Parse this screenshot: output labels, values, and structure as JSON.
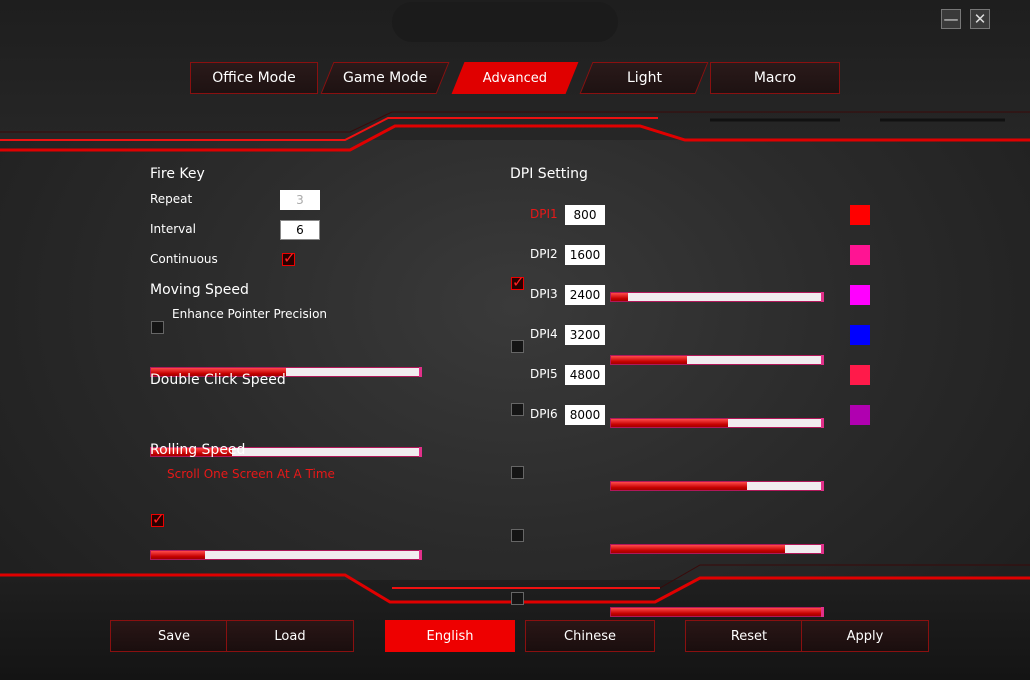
{
  "tabs": [
    {
      "label": "Office Mode"
    },
    {
      "label": "Game Mode"
    },
    {
      "label": "Advanced"
    },
    {
      "label": "Light"
    },
    {
      "label": "Macro"
    }
  ],
  "active_tab": "Advanced",
  "fire_key": {
    "title": "Fire Key",
    "repeat_label": "Repeat",
    "repeat_value": "3",
    "interval_label": "Interval",
    "interval_value": "6",
    "continuous_label": "Continuous",
    "continuous_checked": true
  },
  "moving_speed": {
    "title": "Moving Speed",
    "enhance_label": "Enhance Pointer Precision",
    "enhance_checked": false,
    "level": 0.5
  },
  "double_click": {
    "title": "Double Click Speed",
    "level": 0.3
  },
  "rolling": {
    "title": "Rolling Speed",
    "scroll_label": "Scroll One Screen At A Time",
    "scroll_checked": true,
    "level": 0.2
  },
  "dpi": {
    "title": "DPI Setting",
    "rows": [
      {
        "label": "DPI1",
        "value": "800",
        "checked": true,
        "level": 0.08,
        "color": "#ff0000"
      },
      {
        "label": "DPI2",
        "value": "1600",
        "checked": false,
        "level": 0.36,
        "color": "#ff1493"
      },
      {
        "label": "DPI3",
        "value": "2400",
        "checked": false,
        "level": 0.55,
        "color": "#ff00ff"
      },
      {
        "label": "DPI4",
        "value": "3200",
        "checked": false,
        "level": 0.64,
        "color": "#0000ff"
      },
      {
        "label": "DPI5",
        "value": "4800",
        "checked": false,
        "level": 0.82,
        "color": "#ff1a4a"
      },
      {
        "label": "DPI6",
        "value": "8000",
        "checked": false,
        "level": 1.0,
        "color": "#b000b0"
      }
    ]
  },
  "buttons": {
    "save": "Save",
    "load": "Load",
    "english": "English",
    "chinese": "Chinese",
    "reset": "Reset",
    "apply": "Apply"
  },
  "window": {
    "minimize_icon": "minimize-icon",
    "close_icon": "close-icon"
  },
  "colors": {
    "accent": "#e00000"
  }
}
